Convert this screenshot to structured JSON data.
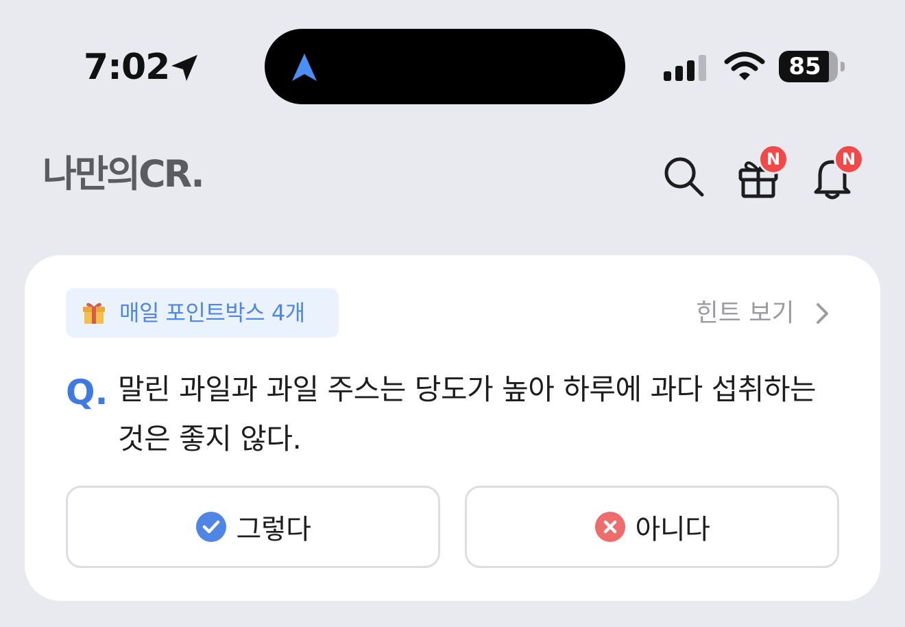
{
  "status_bar": {
    "time": "7:02",
    "location_icon": "location-arrow-icon",
    "island_icon": "navigation-arrow-icon",
    "signal_icon": "cellular-signal-icon",
    "wifi_icon": "wifi-icon",
    "battery_level": "85",
    "battery_percent": 85
  },
  "header": {
    "logo": "나만의CR.",
    "search_icon": "search-icon",
    "gift_icon": "gift-icon",
    "gift_badge": "N",
    "bell_icon": "bell-icon",
    "bell_badge": "N"
  },
  "quiz": {
    "points_label": "매일 포인트박스 4개",
    "hint_label": "힌트 보기",
    "q_mark": "Q.",
    "question": "말린 과일과 과일 주스는 당도가 높아 하루에 과다 섭취하는 것은 좋지 않다.",
    "answers": [
      {
        "label": "그렇다",
        "icon": "check-circle-icon"
      },
      {
        "label": "아니다",
        "icon": "x-circle-icon"
      }
    ]
  },
  "colors": {
    "background": "#e9eaef",
    "accent_blue": "#3f7ae2",
    "badge_red": "#f0494a",
    "no_red": "#ee6c6c"
  }
}
